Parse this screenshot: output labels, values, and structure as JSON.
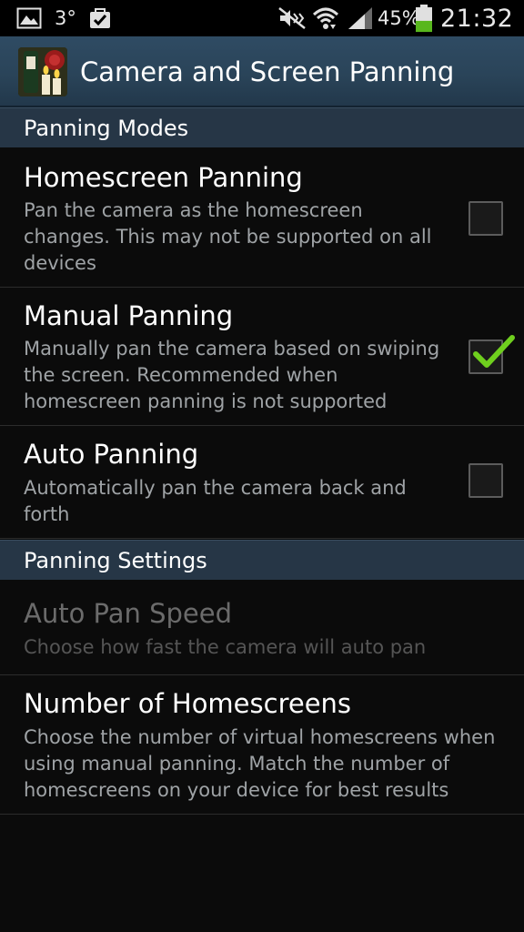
{
  "status_bar": {
    "temperature": "3°",
    "battery_percent": "45%",
    "battery_level": 0.45,
    "time": "21:32",
    "icons": [
      "gallery-icon",
      "checked-bag-icon",
      "mute-icon",
      "wifi-icon",
      "signal-icon",
      "battery-icon"
    ]
  },
  "action_bar": {
    "title": "Camera and Screen Panning",
    "icon": "app-icon-candles"
  },
  "sections": [
    {
      "header": "Panning Modes",
      "items": [
        {
          "title": "Homescreen Panning",
          "summary": "Pan the camera as the homescreen changes. This may not be supported on all devices",
          "checked": false
        },
        {
          "title": "Manual Panning",
          "summary": "Manually pan the camera based on swiping the screen. Recommended when homescreen panning is not supported",
          "checked": true
        },
        {
          "title": "Auto Panning",
          "summary": "Automatically pan the camera back and forth",
          "checked": false
        }
      ]
    },
    {
      "header": "Panning Settings",
      "items": [
        {
          "title": "Auto Pan Speed",
          "summary": "Choose how fast the camera will auto pan",
          "enabled": false
        },
        {
          "title": "Number of Homescreens",
          "summary": "Choose the number of virtual homescreens when using manual panning. Match the number of homescreens on your device for best results",
          "enabled": true
        }
      ]
    }
  ],
  "colors": {
    "action_bar": "#2a4459",
    "section_header": "#263646",
    "checkmark": "#6fcf1e",
    "summary_text": "#9fa3a6"
  }
}
